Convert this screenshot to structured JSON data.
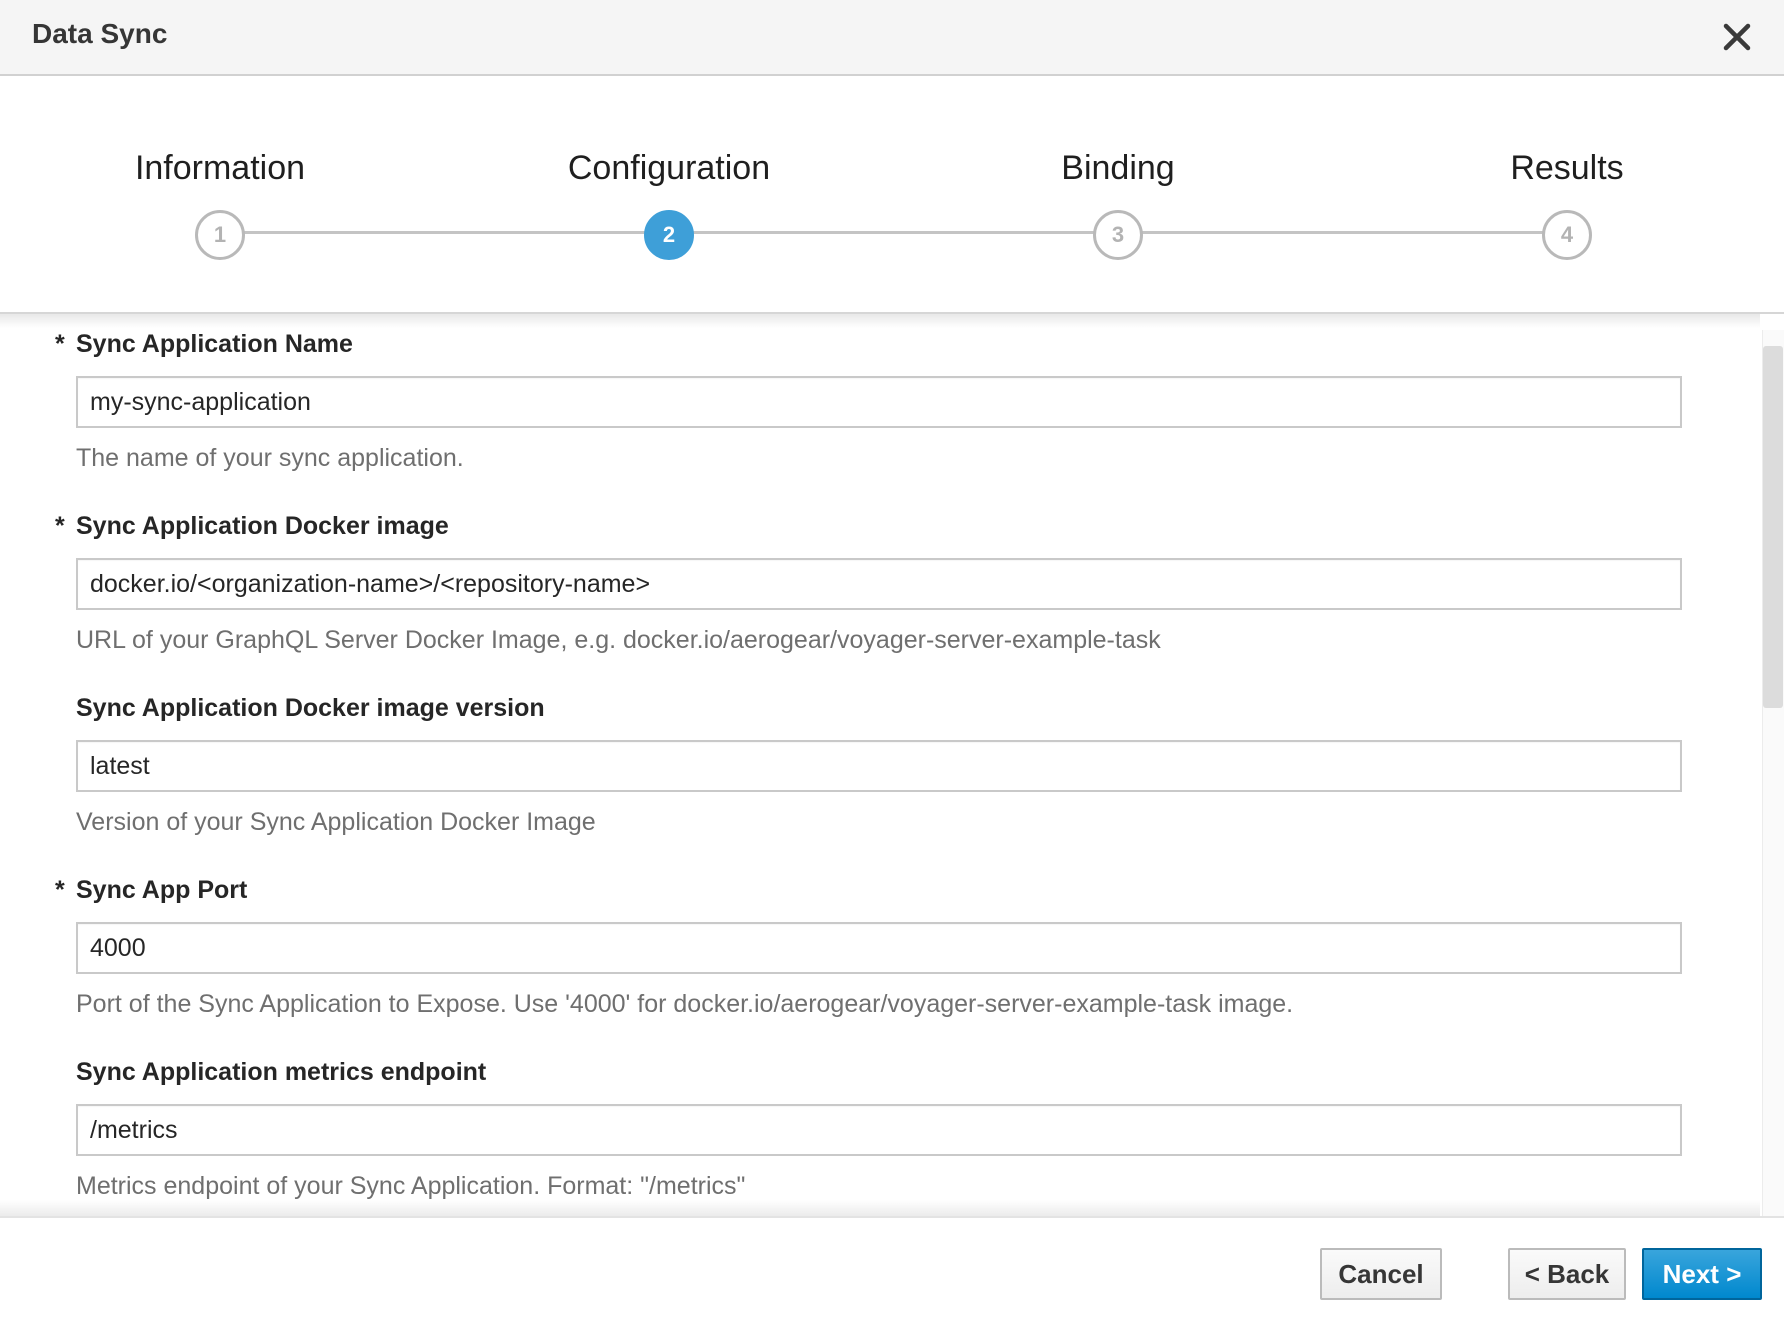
{
  "dialog": {
    "title": "Data Sync",
    "close_icon": "close-icon"
  },
  "wizard": {
    "active_step": 2,
    "steps": [
      {
        "label": "Information",
        "number": "1"
      },
      {
        "label": "Configuration",
        "number": "2"
      },
      {
        "label": "Binding",
        "number": "3"
      },
      {
        "label": "Results",
        "number": "4"
      }
    ],
    "accent_color": "#3e9fd8"
  },
  "form": {
    "fields": [
      {
        "label": "Sync Application Name",
        "required": true,
        "required_mark": "*",
        "value": "my-sync-application",
        "help": "The name of your sync application."
      },
      {
        "label": "Sync Application Docker image",
        "required": true,
        "required_mark": "*",
        "value": "docker.io/<organization-name>/<repository-name>",
        "help": "URL of your GraphQL Server Docker Image, e.g. docker.io/aerogear/voyager-server-example-task"
      },
      {
        "label": "Sync Application Docker image version",
        "required": false,
        "value": "latest",
        "help": "Version of your Sync Application Docker Image"
      },
      {
        "label": "Sync App Port",
        "required": true,
        "required_mark": "*",
        "value": "4000",
        "help": "Port of the Sync Application to Expose. Use '4000' for docker.io/aerogear/voyager-server-example-task image."
      },
      {
        "label": "Sync Application metrics endpoint",
        "required": false,
        "value": "/metrics",
        "help": "Metrics endpoint of your Sync Application. Format: \"/metrics\""
      }
    ]
  },
  "footer": {
    "cancel_label": "Cancel",
    "back_label": "< Back",
    "next_label": "Next >",
    "primary_color": "#0088ce"
  }
}
